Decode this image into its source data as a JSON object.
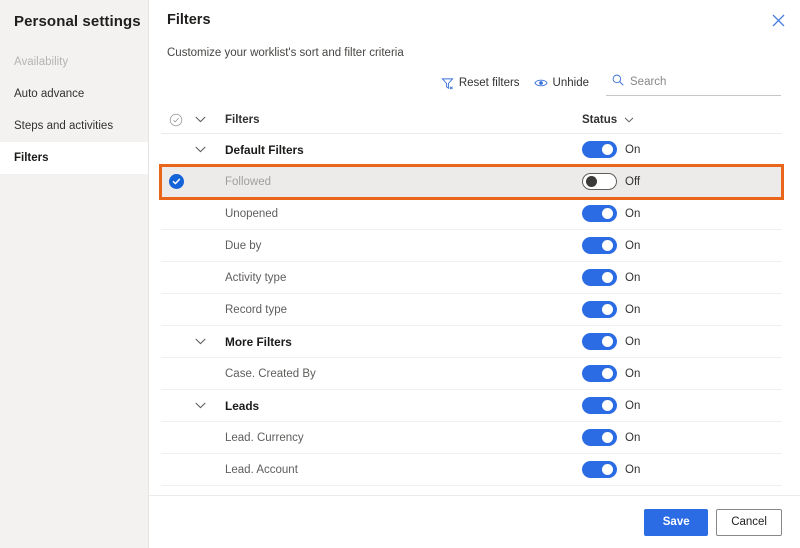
{
  "sidebar": {
    "title": "Personal settings",
    "items": [
      {
        "label": "Availability",
        "state": "disabled"
      },
      {
        "label": "Auto advance",
        "state": "normal"
      },
      {
        "label": "Steps and activities",
        "state": "normal"
      },
      {
        "label": "Filters",
        "state": "selected"
      }
    ]
  },
  "panel": {
    "title": "Filters",
    "subtitle": "Customize your worklist's sort and filter criteria",
    "close_label": "Close"
  },
  "toolbar": {
    "reset_filters_label": "Reset filters",
    "unhide_label": "Unhide",
    "search_placeholder": "Search",
    "search_value": ""
  },
  "grid": {
    "header": {
      "name_column": "Filters",
      "status_column": "Status"
    },
    "rows": [
      {
        "label": "Default Filters",
        "type": "group",
        "status": "On",
        "toggle": "on",
        "selected": false
      },
      {
        "label": "Followed",
        "type": "child",
        "status": "Off",
        "toggle": "off",
        "selected": true
      },
      {
        "label": "Unopened",
        "type": "child",
        "status": "On",
        "toggle": "on",
        "selected": false
      },
      {
        "label": "Due by",
        "type": "child",
        "status": "On",
        "toggle": "on",
        "selected": false
      },
      {
        "label": "Activity type",
        "type": "child",
        "status": "On",
        "toggle": "on",
        "selected": false
      },
      {
        "label": "Record type",
        "type": "child",
        "status": "On",
        "toggle": "on",
        "selected": false
      },
      {
        "label": "More Filters",
        "type": "group",
        "status": "On",
        "toggle": "on",
        "selected": false
      },
      {
        "label": "Case. Created By",
        "type": "child",
        "status": "On",
        "toggle": "on",
        "selected": false
      },
      {
        "label": "Leads",
        "type": "group",
        "status": "On",
        "toggle": "on",
        "selected": false
      },
      {
        "label": "Lead. Currency",
        "type": "child",
        "status": "On",
        "toggle": "on",
        "selected": false
      },
      {
        "label": "Lead. Account",
        "type": "child",
        "status": "On",
        "toggle": "on",
        "selected": false
      }
    ]
  },
  "footer": {
    "save_label": "Save",
    "cancel_label": "Cancel"
  },
  "colors": {
    "accent_blue": "#2b6ce4",
    "highlight_orange": "#e8651a",
    "sidebar_bg": "#f3f2f1",
    "selected_row_bg": "#edebe9"
  }
}
